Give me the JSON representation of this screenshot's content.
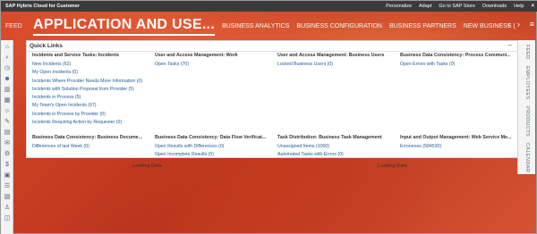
{
  "topbar": {
    "brand": "SAP Hybris Cloud for Customer",
    "links": [
      "Personalize",
      "Adapt",
      "Go to SAP Store",
      "Downloads",
      "Help"
    ],
    "close": "×"
  },
  "nav": {
    "feed": "FEED",
    "active": "APPLICATION AND USE...",
    "tabs": [
      "BUSINESS ANALYTICS",
      "BUSINESS CONFIGURATION",
      "BUSINESS PARTNERS",
      "NEW BUSINESS ("
    ],
    "prev": "‹",
    "next": "›",
    "menu": "≡"
  },
  "sidebar_icons": [
    "home-icon",
    "search-icon",
    "clock-icon",
    "people-icon",
    "chart-icon",
    "calendar-icon",
    "customer-icon",
    "note-icon",
    "document-icon",
    "mail-icon",
    "gear-icon",
    "dollar-icon",
    "box-icon",
    "list-icon",
    "report-icon",
    "user-icon",
    "chat-icon"
  ],
  "rightbar": {
    "tabs": [
      "FEED",
      "EMPLOYEES",
      "PRODUCTS",
      "CALENDAR"
    ]
  },
  "quick_links": {
    "title": "Quick Links",
    "collapse": "–",
    "row1": [
      {
        "heading": "Incidents and Service Tasks: Incidents",
        "links": [
          "New Incidents (62)",
          "My Open Incidents (0)",
          "Incidents Where Provider Needs More Information (0)",
          "Incidents with Solution Proposal from Provider (5)",
          "Incidents in Process (5)",
          "My Team's Open Incidents (67)",
          "Incidents in Process by Provider (0)",
          "Incidents Requiring Action by Requester (0)"
        ]
      },
      {
        "heading": "User and Access Management: Work",
        "links": [
          "Open Tasks (70)"
        ]
      },
      {
        "heading": "User and Access Management: Business Users",
        "links": [
          "Locked Business Users (0)"
        ]
      },
      {
        "heading": "Business Data Consistency: Process Communi...",
        "links": [
          "Open Errors with Tasks (0)"
        ]
      }
    ],
    "row2": [
      {
        "heading": "Business Data Consistency: Business Docume...",
        "links": [
          "Differences of last Week (0)"
        ]
      },
      {
        "heading": "Business Data Consistency: Data Flow Verificat...",
        "links": [
          "Open Results with Differences (0)",
          "Open Incomplete Results (0)"
        ]
      },
      {
        "heading": "Task Distribution: Business Task Management",
        "links": [
          "Unassigned Items (1000)",
          "Automated Tasks with Errors (0)"
        ]
      },
      {
        "heading": "Input and Output Management: Web Service Me...",
        "links": [
          "Erroneous (584530)"
        ]
      }
    ]
  },
  "loading": [
    "Loading Data",
    "Loading Data"
  ]
}
